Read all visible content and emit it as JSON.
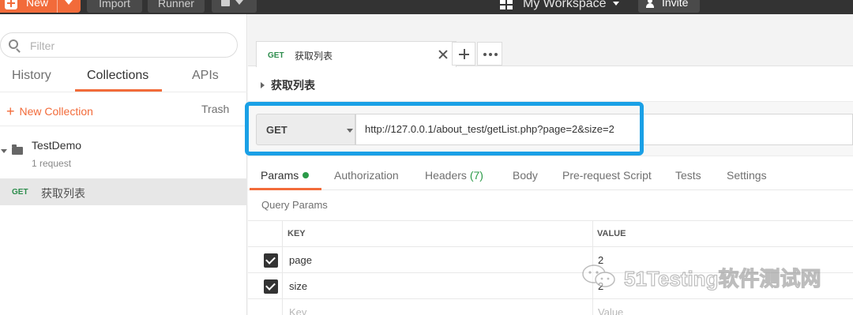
{
  "toolbar": {
    "new_label": "New",
    "import_label": "Import",
    "runner_label": "Runner",
    "workspace_label": "My Workspace",
    "invite_label": "Invite",
    "accent_color": "#f26b3a"
  },
  "sidebar": {
    "filter_placeholder": "Filter",
    "tabs": [
      "History",
      "Collections",
      "APIs"
    ],
    "active_tab": "Collections",
    "new_collection_label": "New Collection",
    "trash_label": "Trash",
    "collection": {
      "name": "TestDemo",
      "count": "1 request",
      "requests": [
        {
          "method": "GET",
          "title": "获取列表"
        }
      ]
    }
  },
  "main": {
    "tab": {
      "method": "GET",
      "title": "获取列表"
    },
    "request_title": "获取列表",
    "method": "GET",
    "url": "http://127.0.0.1/about_test/getList.php?page=2&size=2",
    "param_tabs": [
      {
        "label": "Params",
        "active": true
      },
      {
        "label": "Authorization"
      },
      {
        "label": "Headers",
        "count": "(7)"
      },
      {
        "label": "Body"
      },
      {
        "label": "Pre-request Script"
      },
      {
        "label": "Tests"
      },
      {
        "label": "Settings"
      }
    ],
    "query_params_title": "Query Params",
    "table": {
      "headers": [
        "KEY",
        "VALUE"
      ],
      "rows": [
        {
          "checked": true,
          "key": "page",
          "value": "2"
        },
        {
          "checked": true,
          "key": "size",
          "value": "2"
        }
      ],
      "placeholder": {
        "key": "Key",
        "value": "Value"
      }
    }
  },
  "watermark": {
    "text": "51Testing软件测试网"
  }
}
